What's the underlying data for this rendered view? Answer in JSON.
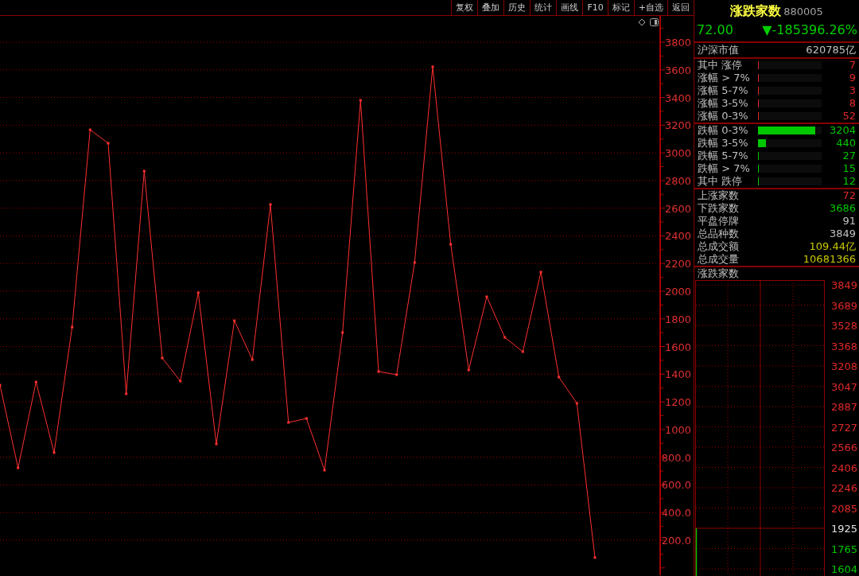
{
  "toolbar": {
    "buttons": [
      "复权",
      "叠加",
      "历史",
      "统计",
      "画线",
      "F10",
      "标记",
      "+自选",
      "返回"
    ]
  },
  "main_chart": {
    "chart_data": {
      "type": "line",
      "categories": [
        null,
        null,
        null,
        null,
        null,
        null,
        null,
        null,
        null,
        null,
        null,
        null,
        null,
        null,
        null,
        null,
        null,
        null,
        null,
        null,
        null,
        null,
        null,
        null,
        null,
        null,
        null,
        null,
        null,
        null,
        null,
        null,
        null,
        null
      ],
      "grid": true,
      "ylim": [
        -53,
        3990
      ],
      "series": [
        {
          "color": "#ff3030",
          "values": [
            1321,
            723,
            1344,
            833,
            1741,
            3167,
            3070,
            1258,
            2868,
            1517,
            1350,
            1989,
            896,
            1787,
            1505,
            2627,
            1051,
            1080,
            706,
            1701,
            3380,
            1419,
            1396,
            2207,
            3622,
            2339,
            1431,
            1960,
            1666,
            1563,
            2138,
            1379,
            1189,
            74
          ]
        }
      ],
      "yticks": [
        {
          "value": 200,
          "label": "200.0"
        },
        {
          "value": 400,
          "label": "400.0"
        },
        {
          "value": 600,
          "label": "600.0"
        },
        {
          "value": 800,
          "label": "800.0"
        },
        {
          "value": 1000,
          "label": "1000"
        },
        {
          "value": 1200,
          "label": "1200"
        },
        {
          "value": 1400,
          "label": "1400"
        },
        {
          "value": 1600,
          "label": "1600"
        },
        {
          "value": 1800,
          "label": "1800"
        },
        {
          "value": 2000,
          "label": "2000"
        },
        {
          "value": 2200,
          "label": "2200"
        },
        {
          "value": 2400,
          "label": "2400"
        },
        {
          "value": 2600,
          "label": "2600"
        },
        {
          "value": 2800,
          "label": "2800"
        },
        {
          "value": 3000,
          "label": "3000"
        },
        {
          "value": 3200,
          "label": "3200"
        },
        {
          "value": 3400,
          "label": "3400"
        },
        {
          "value": 3600,
          "label": "3600"
        },
        {
          "value": 3800,
          "label": "3800"
        }
      ]
    }
  },
  "quote": {
    "name": "涨跌家数",
    "code": "880005",
    "price": "72.00",
    "change_arrow": "▼",
    "change": "-185396.26%"
  },
  "market_value": {
    "label": "沪深市值",
    "value": "620785亿"
  },
  "sections": [
    {
      "rows": [
        {
          "label": "其中 涨停",
          "level": 0.01,
          "value": "7",
          "color": "#e02828"
        },
        {
          "label": "涨幅 > 7%",
          "level": 0.01,
          "value": "9",
          "color": "#e02828"
        },
        {
          "label": "涨幅 5-7%",
          "level": 0.01,
          "value": "3",
          "color": "#e02828"
        },
        {
          "label": "涨幅 3-5%",
          "level": 0.01,
          "value": "8",
          "color": "#e02828"
        },
        {
          "label": "涨幅 0-3%",
          "level": 0.01,
          "value": "52",
          "color": "#e02828"
        }
      ]
    },
    {
      "rows": [
        {
          "label": "跌幅 0-3%",
          "level": 0.9,
          "value": "3204",
          "color": "#00c800"
        },
        {
          "label": "跌幅 3-5%",
          "level": 0.13,
          "value": "440",
          "color": "#00c800"
        },
        {
          "label": "跌幅 5-7%",
          "level": 0.01,
          "value": "27",
          "color": "#00c800"
        },
        {
          "label": "跌幅 > 7%",
          "level": 0.01,
          "value": "15",
          "color": "#00c800"
        },
        {
          "label": "其中 跌停",
          "level": 0.01,
          "value": "12",
          "color": "#00c800"
        }
      ]
    }
  ],
  "summary": [
    {
      "label": "上涨家数",
      "value": "72",
      "color": "#e02828"
    },
    {
      "label": "下跌家数",
      "value": "3686",
      "color": "#00c800"
    },
    {
      "label": "平盘停牌",
      "value": "91",
      "color": "#c0c0c0"
    },
    {
      "label": "总品种数",
      "value": "3849",
      "color": "#c0c0c0"
    },
    {
      "label": "总成交额",
      "value": "109.44亿",
      "color": "#c8c800"
    },
    {
      "label": "总成交量",
      "value": "10681366",
      "color": "#c8c800"
    }
  ],
  "mini_chart": {
    "title": "涨跌家数",
    "axis_labels": [
      {
        "text": "3849",
        "color": "#e02828"
      },
      {
        "text": "3689",
        "color": "#e02828"
      },
      {
        "text": "3528",
        "color": "#e02828"
      },
      {
        "text": "3368",
        "color": "#e02828"
      },
      {
        "text": "3208",
        "color": "#e02828"
      },
      {
        "text": "3047",
        "color": "#e02828"
      },
      {
        "text": "2887",
        "color": "#e02828"
      },
      {
        "text": "2727",
        "color": "#e02828"
      },
      {
        "text": "2566",
        "color": "#e02828"
      },
      {
        "text": "2406",
        "color": "#e02828"
      },
      {
        "text": "2246",
        "color": "#e02828"
      },
      {
        "text": "2085",
        "color": "#e02828"
      },
      {
        "text": "1925",
        "color": "#e0e0e0"
      },
      {
        "text": "1765",
        "color": "#00c800"
      },
      {
        "text": "1604",
        "color": "#00c800"
      }
    ]
  }
}
